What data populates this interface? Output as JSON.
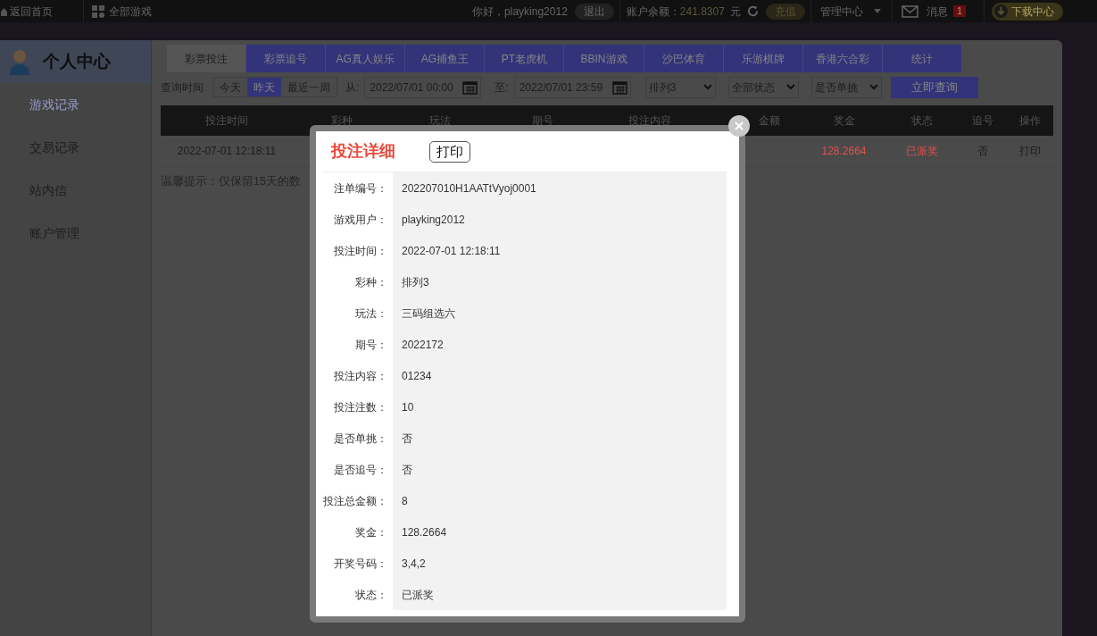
{
  "top_bar": {
    "back_home": "返回首页",
    "all_games": "全部游戏",
    "greeting": "你好，playking2012",
    "logout": "退出",
    "balance_label": "账户余额：",
    "balance": "241.8307",
    "currency": "元",
    "recharge": "充值",
    "admin": "管理中心",
    "messages": "消息",
    "message_count": "1",
    "download": "下载中心"
  },
  "sidebar": {
    "title": "个人中心",
    "items": [
      {
        "label": "游戏记录",
        "selected": true
      },
      {
        "label": "交易记录",
        "selected": false
      },
      {
        "label": "站内信",
        "selected": false
      },
      {
        "label": "账户管理",
        "selected": false
      }
    ]
  },
  "tabs": [
    {
      "label": "彩票投注",
      "selected": true
    },
    {
      "label": "彩票追号",
      "selected": false
    },
    {
      "label": "AG真人娱乐",
      "selected": false
    },
    {
      "label": "AG捕鱼王",
      "selected": false
    },
    {
      "label": "PT老虎机",
      "selected": false
    },
    {
      "label": "BBIN游戏",
      "selected": false
    },
    {
      "label": "沙巴体育",
      "selected": false
    },
    {
      "label": "乐游棋牌",
      "selected": false
    },
    {
      "label": "香港六合彩",
      "selected": false
    },
    {
      "label": "统计",
      "selected": false
    }
  ],
  "filter": {
    "label": "查询时间",
    "quick": [
      {
        "label": "今天",
        "selected": false
      },
      {
        "label": "昨天",
        "selected": true
      },
      {
        "label": "最近一周",
        "selected": false
      }
    ],
    "from_label": "从:",
    "from": "2022/07/01 00:00",
    "to_label": "至:",
    "to": "2022/07/01 23:59",
    "selects": [
      "排列3",
      "全部状态",
      "是否单挑"
    ],
    "query": "立即查询"
  },
  "table": {
    "columns": [
      "投注时间",
      "彩种",
      "玩法",
      "期号",
      "投注内容",
      "金额",
      "奖金",
      "状态",
      "追号",
      "操作"
    ],
    "rows": [
      {
        "time": "2022-07-01 12:18:11",
        "prize": "128.2664",
        "status": "已派奖",
        "chase": "否",
        "action": "打印"
      }
    ]
  },
  "tip": "温馨提示：仅保留15天的数",
  "modal": {
    "title": "投注详细",
    "print": "打印",
    "fields": [
      {
        "label": "注单编号：",
        "value": "202207010H1AATtVyoj0001"
      },
      {
        "label": "游戏用户：",
        "value": "playking2012"
      },
      {
        "label": "投注时间：",
        "value": "2022-07-01 12:18:11"
      },
      {
        "label": "彩种：",
        "value": "排列3"
      },
      {
        "label": "玩法：",
        "value": "三码组选六"
      },
      {
        "label": "期号：",
        "value": "2022172"
      },
      {
        "label": "投注内容：",
        "value": "01234"
      },
      {
        "label": "投注注数：",
        "value": "10"
      },
      {
        "label": "是否单挑：",
        "value": "否"
      },
      {
        "label": "是否追号：",
        "value": "否"
      },
      {
        "label": "投注总金额：",
        "value": "8"
      },
      {
        "label": "奖金：",
        "value": "128.2664"
      },
      {
        "label": "开奖号码：",
        "value": "3,4,2"
      },
      {
        "label": "状态：",
        "value": "已派奖"
      }
    ]
  }
}
